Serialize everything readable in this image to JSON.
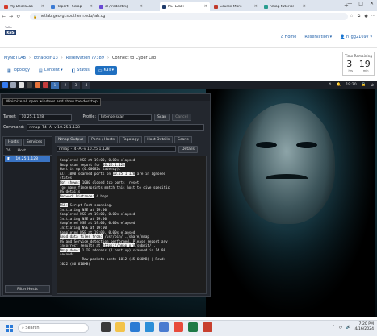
{
  "browser": {
    "tabs": [
      {
        "label": "My DeoraLab",
        "color": "#d43b2a"
      },
      {
        "label": "Report - Scrap",
        "color": "#3b7bd4"
      },
      {
        "label": "ol / redacting",
        "color": "#6a4ad4"
      },
      {
        "label": "NETLAB+",
        "color": "#1f3b6b"
      },
      {
        "label": "Course Mbre",
        "color": "#c0392b"
      },
      {
        "label": "nmap tutorial",
        "color": "#2a9d8f"
      }
    ],
    "url": "netlab.georgi.southern.edu/lab.cg",
    "window_controls": [
      "—",
      "□",
      "✕"
    ]
  },
  "site": {
    "logo_top": "Tuffa",
    "logo_main": "KNS",
    "nav": {
      "home": "Home",
      "reservation": "Reservation ▾",
      "user": "n_gg21697 ▾"
    }
  },
  "breadcrumbs": [
    "MyNETLAB",
    "Ethacker-13",
    "Reservation 77389",
    "Connect to Cyber Lab"
  ],
  "timer": {
    "label": "Time Remaining",
    "hours": "3",
    "minutes": "19",
    "hours_unit": "hrs",
    "minutes_unit": "min"
  },
  "toolbar": {
    "topology": "Topology",
    "content": "Content ▾",
    "status": "Status",
    "kali": "Kali ▾"
  },
  "vm": {
    "panel": {
      "workspaces": [
        "1",
        "2",
        "3",
        "4"
      ],
      "time": "19:20"
    },
    "tooltip": "Minimize all open windows and show the desktop",
    "zenmap": {
      "target_label": "Target:",
      "target_value": "10.25.1.128",
      "profile_label": "Profile:",
      "profile_value": "Intense scan",
      "scan_btn": "Scan",
      "cancel_btn": "Cancel",
      "command_label": "Command:",
      "command_value": "nmap -T4 -A -v 10.25.1.128",
      "left_tabs": [
        "Hosts",
        "Services"
      ],
      "host_cols": [
        "OS",
        "Host"
      ],
      "host_entry": "10.25.1.128",
      "filter_btn": "Filter Hosts",
      "right_tabs": [
        "Nmap Output",
        "Ports / Hosts",
        "Topology",
        "Host Details",
        "Scans"
      ],
      "output_select": "nmap -T4 -A -v 10.25.1.128",
      "details_btn": "Details"
    }
  },
  "output": {
    "l1": "Completed NSE at 19:00, 0.00s elapsed",
    "l2a": "Nmap scan report for ",
    "l2b": "10.25.1.128",
    "l3": "Host is up (0.00082s latency).",
    "l4a": "All 1000 scanned ports on ",
    "l4b": "10.25.1.128",
    "l4c": " are in ignored",
    "l5": "states.",
    "l6a": "Not shown:",
    "l6b": " 1000 closed tcp ports (reset)",
    "l7": "Too many fingerprints match this host to give specific",
    "l8": "OS details",
    "l9a": "Network Distance:",
    "l9b": " 4 hops",
    "l10": "",
    "l11a": "NSE:",
    "l11b": " Script Post-scanning.",
    "l12": "Initiating NSE at 19:00",
    "l13": "Completed NSE at 19:00, 0.00s elapsed",
    "l14": "Initiating NSE at 19:00",
    "l15": "Completed NSE at 19:00, 0.00s elapsed",
    "l16": "Initiating NSE at 19:00",
    "l17": "Completed NSE at 19:00, 0.00s elapsed",
    "l18a": "Read data files from:",
    "l18b": " /usr/bin/../share/nmap",
    "l19": "OS and Service detection performed. Please report any",
    "l20a": "incorrect results at ",
    "l20b": "https://nmap.org",
    "l20c": "/submit/ .",
    "l21a": "Nmap done:",
    "l21b": " 1 IP address (1 host up) scanned in 14.98",
    "l22": "seconds",
    "l23": "           Raw packets sent: 1012 (45.660KB) | Rcvd:",
    "l24": "1022 (86.616KB)"
  },
  "taskbar": {
    "search_placeholder": "Search",
    "clock_time": "7:20 PM",
    "clock_date": "4/16/2024"
  }
}
